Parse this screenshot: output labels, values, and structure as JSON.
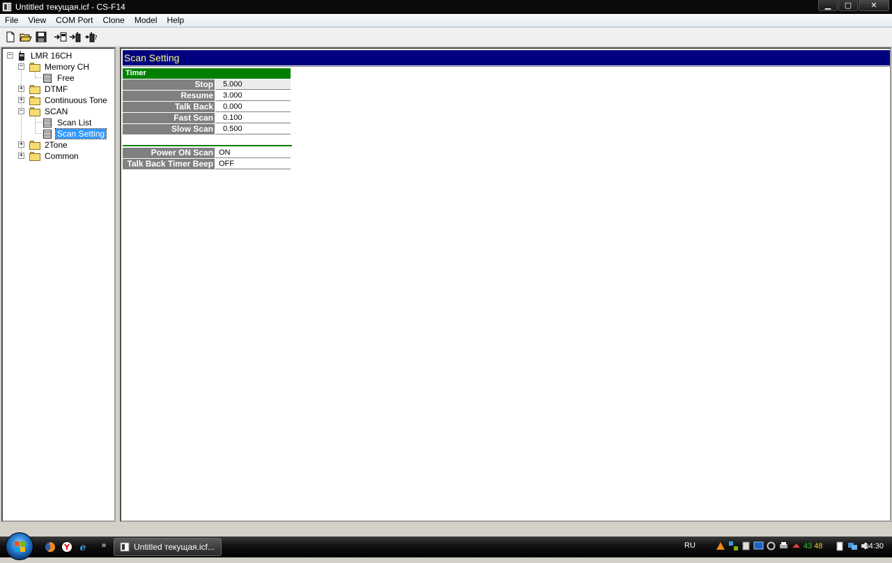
{
  "window": {
    "title": "Untitled текущая.icf - CS-F14",
    "minimize": "▁",
    "maximize": "▢",
    "close": "✕"
  },
  "menu": [
    "File",
    "View",
    "COM Port",
    "Clone",
    "Model",
    "Help"
  ],
  "tree": {
    "root": "LMR 16CH",
    "memory_ch": "Memory CH",
    "free": "Free",
    "dtmf": "DTMF",
    "continuous_tone": "Continuous Tone",
    "scan": "SCAN",
    "scan_list": "Scan List",
    "scan_setting": "Scan Setting",
    "two_tone": "2Tone",
    "common": "Common",
    "expand": "+",
    "collapse": "−"
  },
  "main": {
    "title": "Scan Setting",
    "timer_group": "Timer",
    "timer_rows": [
      {
        "label": "Stop",
        "value": "5.000"
      },
      {
        "label": "Resume",
        "value": "3.000"
      },
      {
        "label": "Talk Back",
        "value": "0.000"
      },
      {
        "label": "Fast Scan",
        "value": "0.100"
      },
      {
        "label": "Slow Scan",
        "value": "0.500"
      }
    ],
    "option_rows": [
      {
        "label": "Power ON Scan",
        "value": "ON"
      },
      {
        "label": "Talk Back Timer Beep",
        "value": "OFF"
      }
    ]
  },
  "taskbar": {
    "task_label": "Untitled текущая.icf...",
    "more": "»",
    "lang": "RU",
    "tray_num_1": "43",
    "tray_num_2": "48",
    "clock": "14:30"
  },
  "colors": {
    "header_bg": "#000080",
    "header_text": "#ffff80",
    "group_bg": "#008000",
    "label_bg": "#808080",
    "selection": "#3399ff"
  }
}
